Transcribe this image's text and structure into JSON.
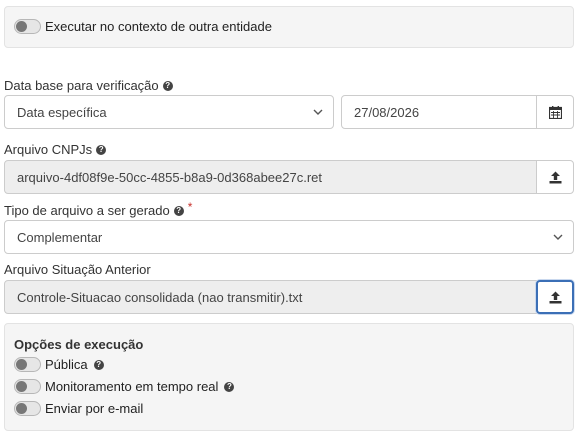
{
  "context_toggle": {
    "label": "Executar no contexto de outra entidade",
    "enabled": false
  },
  "base_date": {
    "label": "Data base para verificação",
    "select_value": "Data específica",
    "date_value": "27/08/2026",
    "icons": {
      "help": "question-circle-icon",
      "chevron": "chevron-down-icon",
      "calendar": "calendar-icon"
    }
  },
  "cnpj_file": {
    "label": "Arquivo CNPJs",
    "value": "arquivo-4df08f9e-50cc-4855-b8a9-0d368abee27c.ret",
    "icons": {
      "help": "question-circle-icon",
      "upload": "upload-icon"
    }
  },
  "file_type": {
    "label": "Tipo de arquivo a ser gerado",
    "required_mark": "*",
    "value": "Complementar"
  },
  "previous_status": {
    "label": "Arquivo Situação Anterior",
    "value": "Controle-Situacao consolidada (nao transmitir).txt"
  },
  "execution_options": {
    "title": "Opções de execução",
    "items": [
      {
        "label": "Pública",
        "enabled": false,
        "has_help": true
      },
      {
        "label": "Monitoramento em tempo real",
        "enabled": false,
        "has_help": true
      },
      {
        "label": "Enviar por e-mail",
        "enabled": false,
        "has_help": false
      }
    ]
  },
  "colors": {
    "panel_bg": "#f5f5f5",
    "readonly_bg": "#eeeeee",
    "focus_border": "#3b6fb6",
    "required": "#c9302c"
  }
}
